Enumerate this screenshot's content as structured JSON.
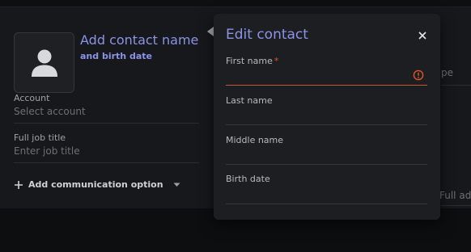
{
  "background": {
    "contact_name_placeholder": "Add contact name",
    "birth_date_link": "and birth date",
    "account": {
      "label": "Account",
      "placeholder": "Select account"
    },
    "job_title": {
      "label": "Full job title",
      "placeholder": "Enter job title"
    },
    "add_communication_label": "Add communication option",
    "right_partial_top": "pe",
    "right_partial_bottom": "Full add"
  },
  "popover": {
    "title": "Edit contact",
    "fields": [
      {
        "label": "First name",
        "required": "*",
        "value": "",
        "error": true
      },
      {
        "label": "Last name",
        "value": ""
      },
      {
        "label": "Middle name",
        "value": ""
      },
      {
        "label": "Birth date",
        "value": ""
      }
    ]
  },
  "colors": {
    "accent": "#8b93e6",
    "error": "#e0542a",
    "surface": "#1d1e21",
    "background": "#17181b"
  },
  "icons": {
    "avatar": "person-icon",
    "add": "plus-icon",
    "dropdown": "caret-down-icon",
    "close": "close-icon",
    "error": "error-icon",
    "popover_pointer": "arrow-left-icon"
  }
}
